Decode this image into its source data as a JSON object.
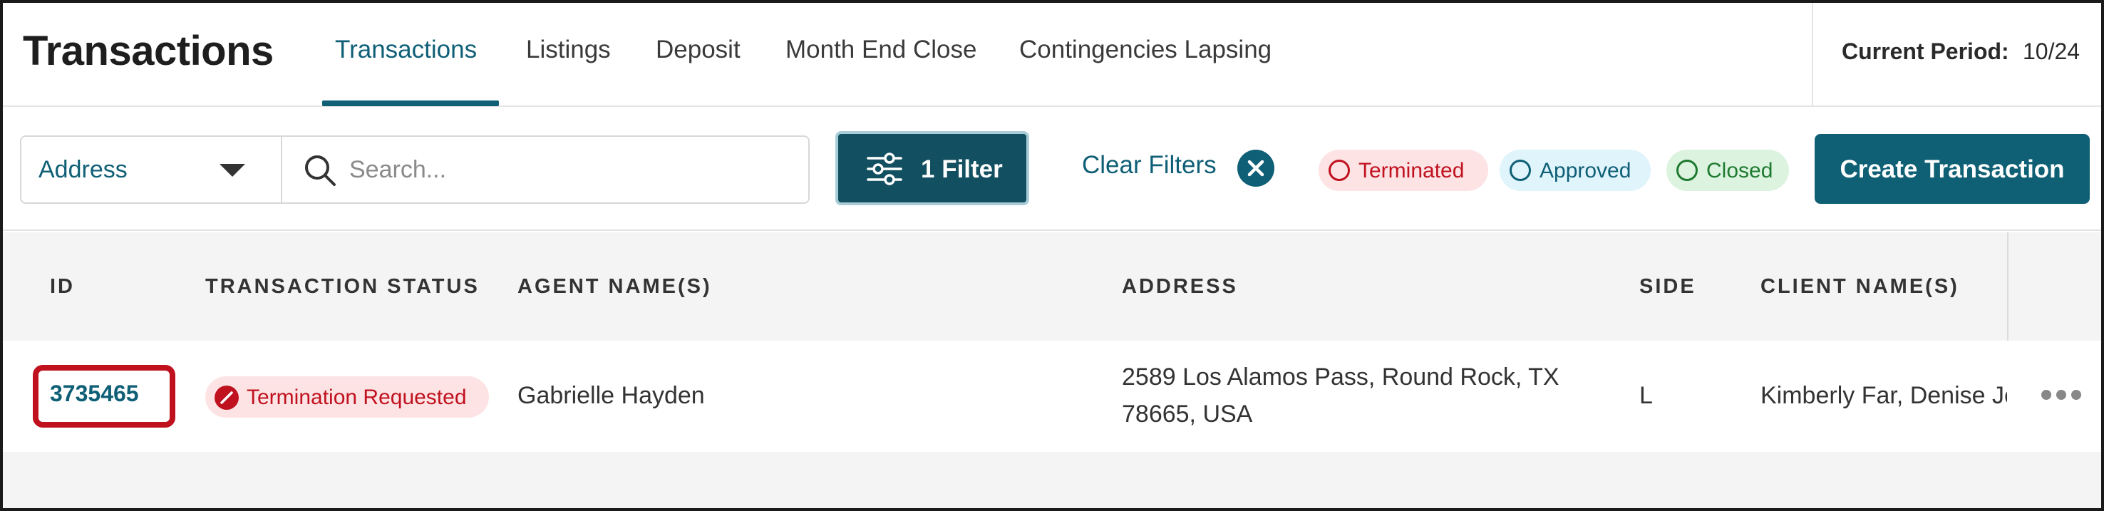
{
  "header": {
    "title": "Transactions",
    "tabs": [
      {
        "label": "Transactions",
        "active": true
      },
      {
        "label": "Listings",
        "active": false
      },
      {
        "label": "Deposit",
        "active": false
      },
      {
        "label": "Month End Close",
        "active": false
      },
      {
        "label": "Contingencies Lapsing",
        "active": false
      }
    ],
    "period_label": "Current Period:",
    "period_value": "10/24"
  },
  "toolbar": {
    "search_field_select": "Address",
    "search_placeholder": "Search...",
    "filter_label": "1 Filter",
    "clear_filters_label": "Clear Filters",
    "status_pills": [
      {
        "label": "Terminated",
        "color": "#c0111f"
      },
      {
        "label": "Approved",
        "color": "#0f5f76"
      },
      {
        "label": "Closed",
        "color": "#1d7a2f"
      }
    ],
    "create_label": "Create Transaction"
  },
  "table": {
    "columns": [
      "ID",
      "TRANSACTION STATUS",
      "AGENT NAME(S)",
      "ADDRESS",
      "SIDE",
      "CLIENT NAME(S)"
    ],
    "rows": [
      {
        "id": "3735465",
        "status": "Termination Requested",
        "agent": "Gabrielle Hayden",
        "address_line1": "2589 Los Alamos Pass, Round Rock, TX",
        "address_line2": "78665, USA",
        "side": "L",
        "client": "Kimberly Far, Denise Je"
      }
    ]
  },
  "colors": {
    "accent": "#0f5f76",
    "danger": "#c0111f",
    "success": "#1d7a2f"
  }
}
